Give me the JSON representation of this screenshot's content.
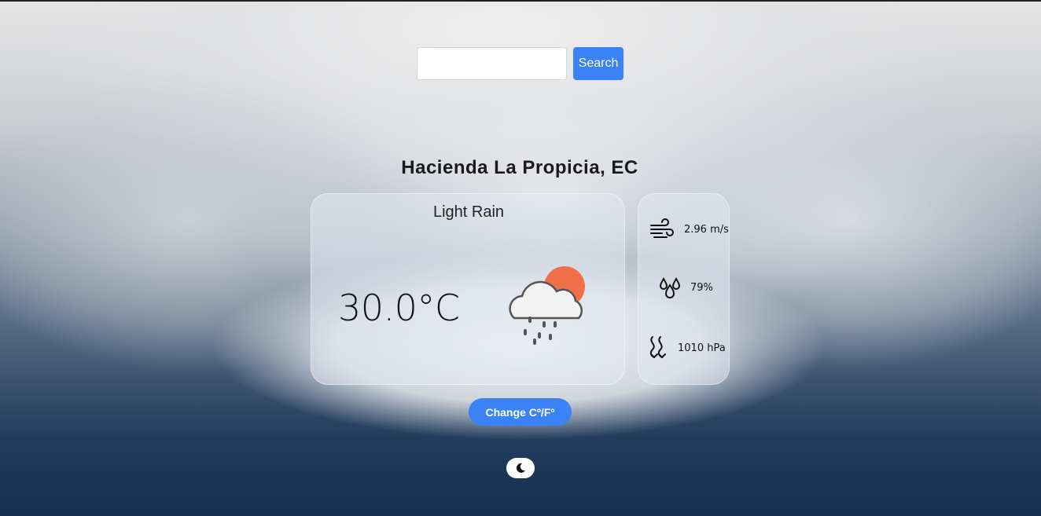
{
  "search": {
    "value": "",
    "placeholder": "",
    "button_label": "Search"
  },
  "location": "Hacienda La Propicia, EC",
  "current": {
    "condition": "Light Rain",
    "temperature": "30.0°C",
    "icon": "cloud-sun-rain-icon"
  },
  "stats": {
    "wind": {
      "icon": "wind-icon",
      "value": "2.96 m/s"
    },
    "humidity": {
      "icon": "humidity-drops-icon",
      "value": "79%"
    },
    "pressure": {
      "icon": "pressure-icon",
      "value": "1010 hPa"
    }
  },
  "controls": {
    "unit_toggle_label": "Change Cº/Fº",
    "theme_toggle_icon": "moon-icon"
  },
  "colors": {
    "accent": "#3b82f6",
    "sun": "#f0704a"
  }
}
